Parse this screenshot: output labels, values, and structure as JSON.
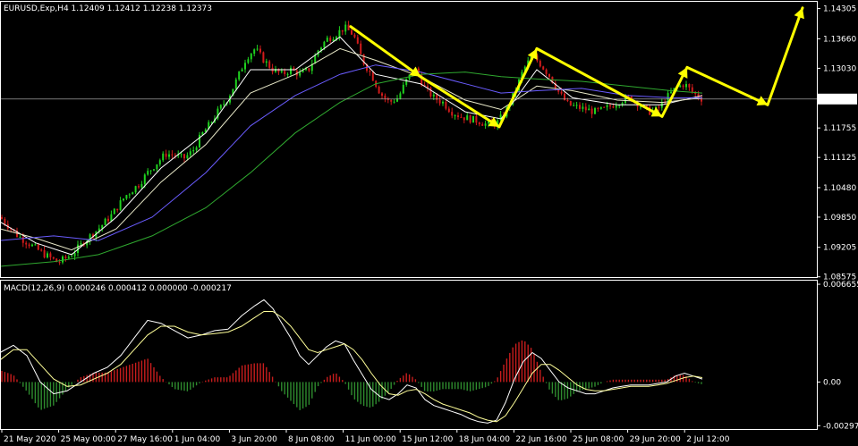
{
  "price_header": "EURUSD,Exp,H4  1.12409 1.12412 1.12238 1.12373",
  "macd_header": "MACD(12,26,9) 0.000246 0.000412 0.000000 -0.000217",
  "colors": {
    "background": "#000000",
    "border": "#ffffff",
    "bull": "#1fd31f",
    "bear": "#d11b1b",
    "ma_fast": "#ffffff",
    "ma_mid": "#e8e8c8",
    "ma_blue": "#6a5cff",
    "ma_green": "#2fa82f",
    "arrow": "#ffff00",
    "macd_line": "#ffffff",
    "signal_line": "#ffff99",
    "hist_pos": "#c81d1d",
    "hist_neg": "#2e8b2e"
  },
  "chart_data": [
    {
      "type": "candlestick",
      "title": "EURUSD,Exp,H4",
      "ohlc_latest": {
        "open": 1.12409,
        "high": 1.12412,
        "low": 1.12238,
        "close": 1.12373
      },
      "current_price_label": "1.12373",
      "current_price": 1.12373,
      "ylim": [
        1.0857,
        1.1445
      ],
      "y_ticks": [
        "1.14305",
        "1.13660",
        "1.13030",
        "1.12373",
        "1.11755",
        "1.11125",
        "1.10480",
        "1.09850",
        "1.09205",
        "1.08575"
      ],
      "y_tick_values": [
        1.14305,
        1.1366,
        1.1303,
        1.12373,
        1.11755,
        1.11125,
        1.1048,
        1.0985,
        1.09205,
        1.08575
      ],
      "x_ticks": [
        "21 May 2020",
        "25 May 00:00",
        "27 May 16:00",
        "1 Jun 04:00",
        "3 Jun 20:00",
        "8 Jun 08:00",
        "11 Jun 00:00",
        "15 Jun 12:00",
        "18 Jun 04:00",
        "22 Jun 16:00",
        "25 Jun 08:00",
        "29 Jun 20:00",
        "2 Jul 12:00"
      ],
      "price_path": [
        [
          0,
          1.0985
        ],
        [
          10,
          1.0965
        ],
        [
          20,
          1.0945
        ],
        [
          35,
          1.0925
        ],
        [
          50,
          1.0905
        ],
        [
          65,
          1.0888
        ],
        [
          80,
          1.0905
        ],
        [
          95,
          1.0935
        ],
        [
          110,
          1.096
        ],
        [
          125,
          1.099
        ],
        [
          140,
          1.103
        ],
        [
          155,
          1.1055
        ],
        [
          165,
          1.108
        ],
        [
          175,
          1.11
        ],
        [
          185,
          1.112
        ],
        [
          195,
          1.1118
        ],
        [
          205,
          1.111
        ],
        [
          215,
          1.1125
        ],
        [
          225,
          1.116
        ],
        [
          235,
          1.1185
        ],
        [
          245,
          1.1215
        ],
        [
          255,
          1.124
        ],
        [
          265,
          1.128
        ],
        [
          275,
          1.1325
        ],
        [
          285,
          1.1345
        ],
        [
          295,
          1.132
        ],
        [
          305,
          1.13
        ],
        [
          315,
          1.129
        ],
        [
          325,
          1.13
        ],
        [
          335,
          1.129
        ],
        [
          345,
          1.13
        ],
        [
          355,
          1.134
        ],
        [
          365,
          1.1365
        ],
        [
          375,
          1.1375
        ],
        [
          385,
          1.139
        ],
        [
          395,
          1.1375
        ],
        [
          405,
          1.132
        ],
        [
          415,
          1.129
        ],
        [
          425,
          1.125
        ],
        [
          435,
          1.123
        ],
        [
          445,
          1.124
        ],
        [
          455,
          1.128
        ],
        [
          465,
          1.13
        ],
        [
          475,
          1.126
        ],
        [
          485,
          1.124
        ],
        [
          495,
          1.123
        ],
        [
          505,
          1.121
        ],
        [
          515,
          1.12
        ],
        [
          525,
          1.1195
        ],
        [
          535,
          1.119
        ],
        [
          545,
          1.1182
        ],
        [
          555,
          1.1185
        ],
        [
          565,
          1.121
        ],
        [
          575,
          1.125
        ],
        [
          585,
          1.13
        ],
        [
          595,
          1.133
        ],
        [
          605,
          1.131
        ],
        [
          615,
          1.1285
        ],
        [
          625,
          1.125
        ],
        [
          635,
          1.1225
        ],
        [
          645,
          1.122
        ],
        [
          655,
          1.1215
        ],
        [
          665,
          1.121
        ],
        [
          675,
          1.1215
        ],
        [
          685,
          1.1225
        ],
        [
          695,
          1.1235
        ],
        [
          705,
          1.124
        ],
        [
          715,
          1.1225
        ],
        [
          725,
          1.121
        ],
        [
          735,
          1.1215
        ],
        [
          745,
          1.124
        ],
        [
          755,
          1.126
        ],
        [
          765,
          1.127
        ],
        [
          775,
          1.125
        ],
        [
          785,
          1.1237
        ]
      ],
      "moving_averages": [
        {
          "color_key": "ma_fast",
          "values": [
            [
              0,
              1.0975
            ],
            [
              40,
              1.093
            ],
            [
              80,
              1.0905
            ],
            [
              130,
              1.0985
            ],
            [
              180,
              1.109
            ],
            [
              230,
              1.1165
            ],
            [
              280,
              1.13
            ],
            [
              330,
              1.13
            ],
            [
              380,
              1.137
            ],
            [
              420,
              1.129
            ],
            [
              470,
              1.127
            ],
            [
              520,
              1.121
            ],
            [
              560,
              1.1195
            ],
            [
              600,
              1.13
            ],
            [
              640,
              1.124
            ],
            [
              690,
              1.1225
            ],
            [
              740,
              1.1225
            ],
            [
              785,
              1.1245
            ]
          ]
        },
        {
          "color_key": "ma_mid",
          "values": [
            [
              0,
              1.096
            ],
            [
              40,
              1.094
            ],
            [
              80,
              1.0915
            ],
            [
              130,
              1.096
            ],
            [
              180,
              1.106
            ],
            [
              230,
              1.114
            ],
            [
              280,
              1.125
            ],
            [
              330,
              1.129
            ],
            [
              380,
              1.1345
            ],
            [
              420,
              1.132
            ],
            [
              470,
              1.1285
            ],
            [
              520,
              1.1235
            ],
            [
              560,
              1.1215
            ],
            [
              600,
              1.1265
            ],
            [
              640,
              1.1255
            ],
            [
              690,
              1.1235
            ],
            [
              740,
              1.123
            ],
            [
              785,
              1.124
            ]
          ]
        },
        {
          "color_key": "ma_blue",
          "values": [
            [
              0,
              1.0935
            ],
            [
              60,
              1.0945
            ],
            [
              110,
              1.0935
            ],
            [
              170,
              1.0985
            ],
            [
              230,
              1.108
            ],
            [
              280,
              1.118
            ],
            [
              330,
              1.1245
            ],
            [
              380,
              1.129
            ],
            [
              420,
              1.131
            ],
            [
              470,
              1.1295
            ],
            [
              520,
              1.127
            ],
            [
              560,
              1.125
            ],
            [
              600,
              1.1255
            ],
            [
              650,
              1.126
            ],
            [
              700,
              1.1245
            ],
            [
              750,
              1.124
            ],
            [
              785,
              1.124
            ]
          ]
        },
        {
          "color_key": "ma_green",
          "values": [
            [
              0,
              1.088
            ],
            [
              60,
              1.089
            ],
            [
              110,
              1.0905
            ],
            [
              170,
              1.0945
            ],
            [
              230,
              1.1005
            ],
            [
              280,
              1.108
            ],
            [
              330,
              1.1165
            ],
            [
              380,
              1.123
            ],
            [
              420,
              1.127
            ],
            [
              470,
              1.129
            ],
            [
              520,
              1.1295
            ],
            [
              560,
              1.1285
            ],
            [
              600,
              1.128
            ],
            [
              650,
              1.1275
            ],
            [
              700,
              1.1265
            ],
            [
              750,
              1.1255
            ],
            [
              785,
              1.125
            ]
          ]
        }
      ],
      "annotation_path": [
        [
          392,
          1.1392
        ],
        [
          470,
          1.1285
        ],
        [
          558,
          1.1178
        ],
        [
          600,
          1.1345
        ],
        [
          740,
          1.12
        ],
        [
          768,
          1.1305
        ],
        [
          858,
          1.1225
        ],
        [
          897,
          1.1432
        ]
      ]
    },
    {
      "type": "macd",
      "title": "MACD(12,26,9)",
      "values": {
        "macd": 0.000246,
        "signal": 0.000412,
        "third": 0.0,
        "fourth": -0.000217
      },
      "ylim": [
        -0.0032,
        0.0069
      ],
      "y_ticks": [
        "0.006655",
        "0.00",
        "-0.002973"
      ],
      "y_tick_values": [
        0.006655,
        0.0,
        -0.002973
      ],
      "macd_line": [
        [
          0,
          0.002
        ],
        [
          15,
          0.0025
        ],
        [
          30,
          0.0018
        ],
        [
          45,
          0.0
        ],
        [
          60,
          -0.0008
        ],
        [
          75,
          -0.0006
        ],
        [
          90,
          0.0
        ],
        [
          105,
          0.0006
        ],
        [
          120,
          0.001
        ],
        [
          135,
          0.0018
        ],
        [
          150,
          0.003
        ],
        [
          165,
          0.0042
        ],
        [
          180,
          0.004
        ],
        [
          195,
          0.0035
        ],
        [
          210,
          0.003
        ],
        [
          225,
          0.0032
        ],
        [
          240,
          0.0035
        ],
        [
          255,
          0.0036
        ],
        [
          270,
          0.0045
        ],
        [
          285,
          0.0052
        ],
        [
          295,
          0.0056
        ],
        [
          305,
          0.005
        ],
        [
          315,
          0.004
        ],
        [
          325,
          0.003
        ],
        [
          335,
          0.0018
        ],
        [
          345,
          0.0012
        ],
        [
          355,
          0.0018
        ],
        [
          365,
          0.0024
        ],
        [
          375,
          0.0028
        ],
        [
          385,
          0.0026
        ],
        [
          395,
          0.0015
        ],
        [
          405,
          0.0005
        ],
        [
          415,
          -0.0005
        ],
        [
          425,
          -0.001
        ],
        [
          435,
          -0.0012
        ],
        [
          445,
          -0.0008
        ],
        [
          455,
          -0.0002
        ],
        [
          465,
          -0.0004
        ],
        [
          475,
          -0.0012
        ],
        [
          485,
          -0.0016
        ],
        [
          495,
          -0.0018
        ],
        [
          505,
          -0.002
        ],
        [
          515,
          -0.0022
        ],
        [
          525,
          -0.0025
        ],
        [
          535,
          -0.0027
        ],
        [
          545,
          -0.0028
        ],
        [
          555,
          -0.0026
        ],
        [
          565,
          -0.0014
        ],
        [
          575,
          0.0002
        ],
        [
          585,
          0.0014
        ],
        [
          595,
          0.002
        ],
        [
          605,
          0.0016
        ],
        [
          615,
          0.0008
        ],
        [
          625,
          0.0
        ],
        [
          635,
          -0.0004
        ],
        [
          645,
          -0.0006
        ],
        [
          655,
          -0.0008
        ],
        [
          665,
          -0.0008
        ],
        [
          675,
          -0.0006
        ],
        [
          685,
          -0.0004
        ],
        [
          695,
          -0.0003
        ],
        [
          705,
          -0.0002
        ],
        [
          715,
          -0.0002
        ],
        [
          725,
          -0.0002
        ],
        [
          735,
          -0.0001
        ],
        [
          745,
          0.0
        ],
        [
          755,
          0.0004
        ],
        [
          765,
          0.0006
        ],
        [
          775,
          0.0004
        ],
        [
          785,
          0.0002
        ]
      ],
      "signal_line": [
        [
          0,
          0.0015
        ],
        [
          15,
          0.0022
        ],
        [
          30,
          0.0022
        ],
        [
          45,
          0.0012
        ],
        [
          60,
          0.0002
        ],
        [
          75,
          -0.0003
        ],
        [
          90,
          -0.0002
        ],
        [
          105,
          0.0002
        ],
        [
          120,
          0.0006
        ],
        [
          135,
          0.0012
        ],
        [
          150,
          0.0022
        ],
        [
          165,
          0.0032
        ],
        [
          180,
          0.0038
        ],
        [
          195,
          0.0038
        ],
        [
          210,
          0.0034
        ],
        [
          225,
          0.0032
        ],
        [
          240,
          0.0033
        ],
        [
          255,
          0.0034
        ],
        [
          270,
          0.0038
        ],
        [
          285,
          0.0044
        ],
        [
          295,
          0.0048
        ],
        [
          305,
          0.0048
        ],
        [
          315,
          0.0044
        ],
        [
          325,
          0.0038
        ],
        [
          335,
          0.003
        ],
        [
          345,
          0.0022
        ],
        [
          355,
          0.002
        ],
        [
          365,
          0.0022
        ],
        [
          375,
          0.0024
        ],
        [
          385,
          0.0026
        ],
        [
          395,
          0.0022
        ],
        [
          405,
          0.0015
        ],
        [
          415,
          0.0006
        ],
        [
          425,
          -0.0002
        ],
        [
          435,
          -0.0008
        ],
        [
          445,
          -0.0009
        ],
        [
          455,
          -0.0006
        ],
        [
          465,
          -0.0005
        ],
        [
          475,
          -0.0008
        ],
        [
          485,
          -0.0012
        ],
        [
          495,
          -0.0015
        ],
        [
          505,
          -0.0017
        ],
        [
          515,
          -0.0019
        ],
        [
          525,
          -0.0021
        ],
        [
          535,
          -0.0024
        ],
        [
          545,
          -0.0026
        ],
        [
          555,
          -0.0027
        ],
        [
          565,
          -0.0023
        ],
        [
          575,
          -0.0014
        ],
        [
          585,
          -0.0004
        ],
        [
          595,
          0.0006
        ],
        [
          605,
          0.0012
        ],
        [
          615,
          0.0012
        ],
        [
          625,
          0.0008
        ],
        [
          635,
          0.0003
        ],
        [
          645,
          -0.0002
        ],
        [
          655,
          -0.0005
        ],
        [
          665,
          -0.0006
        ],
        [
          675,
          -0.0006
        ],
        [
          685,
          -0.0005
        ],
        [
          695,
          -0.0004
        ],
        [
          705,
          -0.0003
        ],
        [
          715,
          -0.0003
        ],
        [
          725,
          -0.0003
        ],
        [
          735,
          -0.0002
        ],
        [
          745,
          -0.0001
        ],
        [
          755,
          0.0001
        ],
        [
          765,
          0.0003
        ],
        [
          775,
          0.0004
        ],
        [
          785,
          0.0003
        ]
      ]
    }
  ]
}
